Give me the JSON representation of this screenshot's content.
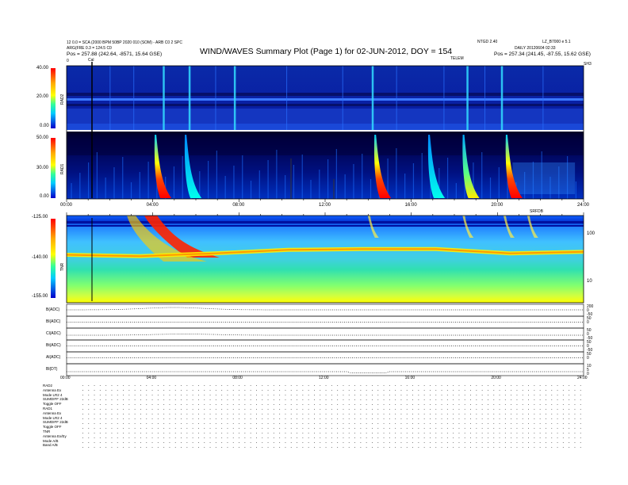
{
  "header": {
    "title": "WIND/WAVES Summary Plot (Page 1) for 02-JUN-2012, DOY = 154",
    "left_line1": "12 0.0 = SCA (2000 BPM 50BP 2020 010 (SOM) - ARB C0 2 SPC",
    "left_line2": "ARG(FRE 0.3 = 124.5 C0",
    "left_line3": "Pos = 257.88 (242.64, -8571, 15.64 GSE)",
    "right_line1": "LZ_B7000 e 5.1",
    "right_line2": "DAILY 20120604 02:33",
    "right_line3": "Pos = 257.34 (241.45, -87.55, 15.62 GSE)",
    "center_small1": "NTGD 2.40",
    "center_small2": "TELEM",
    "cal_mark": "Cal",
    "top_right_corner": "SH3",
    "left_corner": "0"
  },
  "panels": {
    "rad2": {
      "name": "RAD2",
      "ticks": [
        "40.00",
        "20.00",
        "0.00"
      ],
      "ylim": [
        0,
        40
      ]
    },
    "rad1": {
      "name": "RAD1",
      "ticks": [
        "50.00",
        "30.00",
        "0.00"
      ],
      "ylim": [
        0,
        50
      ]
    },
    "tnr": {
      "name": "TNR",
      "ticks": [
        "-125.00",
        "-140.00",
        "-155.00"
      ],
      "right_ticks": [
        "100",
        "10"
      ],
      "corner": "SRFDB"
    },
    "time_ticks_top": [
      "00:00",
      "04:00",
      "08:00",
      "12:00",
      "16:00",
      "20:00",
      "24:00"
    ],
    "time_ticks_bottom": [
      "00:00",
      "04:00",
      "08:00",
      "12:00",
      "16:00",
      "20:00",
      "24:00"
    ]
  },
  "mag_panels": [
    {
      "label": "B(ADC)",
      "right": [
        "200",
        "0",
        "-50"
      ]
    },
    {
      "label": "Bl(ADC)",
      "right": [
        "50",
        "0"
      ]
    },
    {
      "label": "Cl(ADC)",
      "right": [
        "50",
        "0",
        "-50"
      ]
    },
    {
      "label": "Bt(ADC)",
      "right": [
        "50",
        "0",
        "-50"
      ]
    },
    {
      "label": "Al(ADC)",
      "right": [
        "50",
        "0"
      ]
    },
    {
      "label": "Bl(DT)",
      "right": [
        "10",
        "5",
        "0"
      ]
    }
  ],
  "footer": {
    "rad2": [
      "RAD2",
      "Antenna  Ex",
      "Mode  LR2 4",
      "SUMDIFF 22dB",
      "Toggle  OFF"
    ],
    "rad1": [
      "RAD1",
      "Antenna  Ex",
      "Mode  LR2 4",
      "SUMDIFF 22dB",
      "Toggle  OFF"
    ],
    "tnr": [
      "TNR",
      "Antenna  Ex/Ey",
      "Mode  A/B",
      "Band  A/B"
    ]
  },
  "chart_data": [
    {
      "type": "heatmap",
      "title": "WIND/WAVES Summary Plot (Page 1) for 02-JUN-2012, DOY = 154",
      "panel": "RAD2",
      "x_range_hours": [
        0,
        24
      ],
      "ylim": [
        0,
        40
      ],
      "ylabel": "RAD2",
      "bursts_hours": [
        4.5,
        5.7,
        7.8,
        14.2,
        18.6,
        20.2
      ]
    },
    {
      "type": "heatmap",
      "panel": "RAD1",
      "x_range_hours": [
        0,
        24
      ],
      "ylim": [
        0,
        50
      ],
      "ylabel": "RAD1",
      "type_iii_bursts": [
        {
          "time_h": 4.2,
          "peak": "red"
        },
        {
          "time_h": 5.6,
          "peak": "cyan"
        },
        {
          "time_h": 14.4,
          "peak": "red"
        },
        {
          "time_h": 16.9,
          "peak": "cyan"
        },
        {
          "time_h": 18.5,
          "peak": "yellow"
        },
        {
          "time_h": 20.5,
          "peak": "red"
        }
      ]
    },
    {
      "type": "heatmap",
      "panel": "TNR",
      "x_range_hours": [
        0,
        24
      ],
      "ylim": [
        -155,
        -125
      ],
      "ylabel": "TNR",
      "plasma_line_level": [
        -138.5,
        -139.0,
        -138.0,
        -136.8,
        -136.5,
        -136.5,
        -138.0,
        -137.5
      ]
    }
  ],
  "colors": {
    "bg_dark": "#0a1a7a",
    "axis": "#000000"
  }
}
